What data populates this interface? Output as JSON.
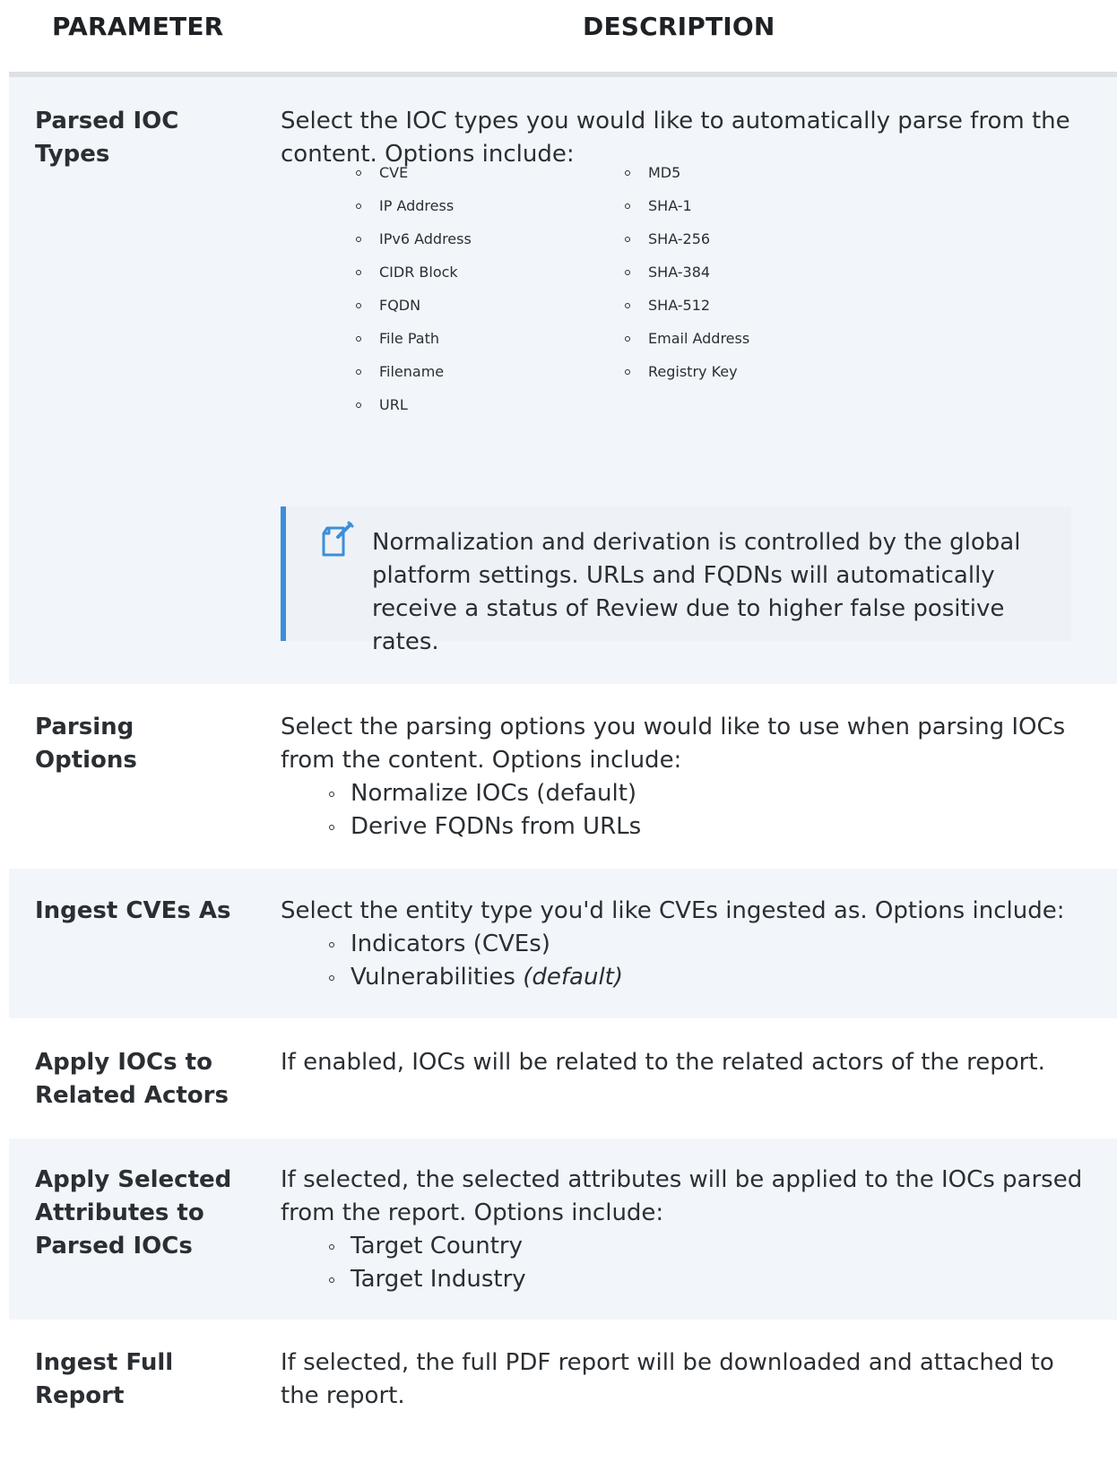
{
  "header": {
    "parameter": "PARAMETER",
    "description": "DESCRIPTION"
  },
  "rows": [
    {
      "parameter": "Parsed IOC Types",
      "description": "Select the IOC types you would like to automatically parse from the content. Options include:",
      "options_left": [
        "CVE",
        "IP Address",
        "IPv6 Address",
        "CIDR Block",
        "FQDN",
        "File Path",
        "Filename",
        "URL"
      ],
      "options_right": [
        "MD5",
        "SHA-1",
        "SHA-256",
        "SHA-384",
        "SHA-512",
        "Email Address",
        "Registry Key"
      ],
      "note": "Normalization and derivation is controlled by the global platform settings. URLs and FQDNs will automatically receive a status of Review due to higher false positive rates."
    },
    {
      "parameter": "Parsing Options",
      "description": "Select the parsing options you would like to use when parsing IOCs from the content.  Options include:",
      "options": [
        "Normalize IOCs (default)",
        "Derive FQDNs from URLs"
      ]
    },
    {
      "parameter": "Ingest CVEs As",
      "description": "Select the entity type you'd like CVEs ingested as.  Options include:",
      "options": [
        "Indicators (CVEs)",
        "Vulnerabilities"
      ],
      "default_marker": "(default)"
    },
    {
      "parameter": "Apply IOCs to Related Actors",
      "description": "If enabled, IOCs will be related to the related actors of the report."
    },
    {
      "parameter": "Apply Selected Attributes to Parsed IOCs",
      "description": "If selected, the selected attributes will be applied to the IOCs parsed from the report.  Options include:",
      "options": [
        "Target Country",
        "Target Industry"
      ]
    },
    {
      "parameter": "Ingest Full Report",
      "description": "If selected, the full PDF report will be downloaded and attached to the report."
    }
  ],
  "colors": {
    "row_alt": "#f2f5f9",
    "note_accent": "#3d8ed8",
    "note_background": "#eef2f6",
    "text": "#2b2f33"
  },
  "icons": {
    "note": "note-edit-icon"
  }
}
